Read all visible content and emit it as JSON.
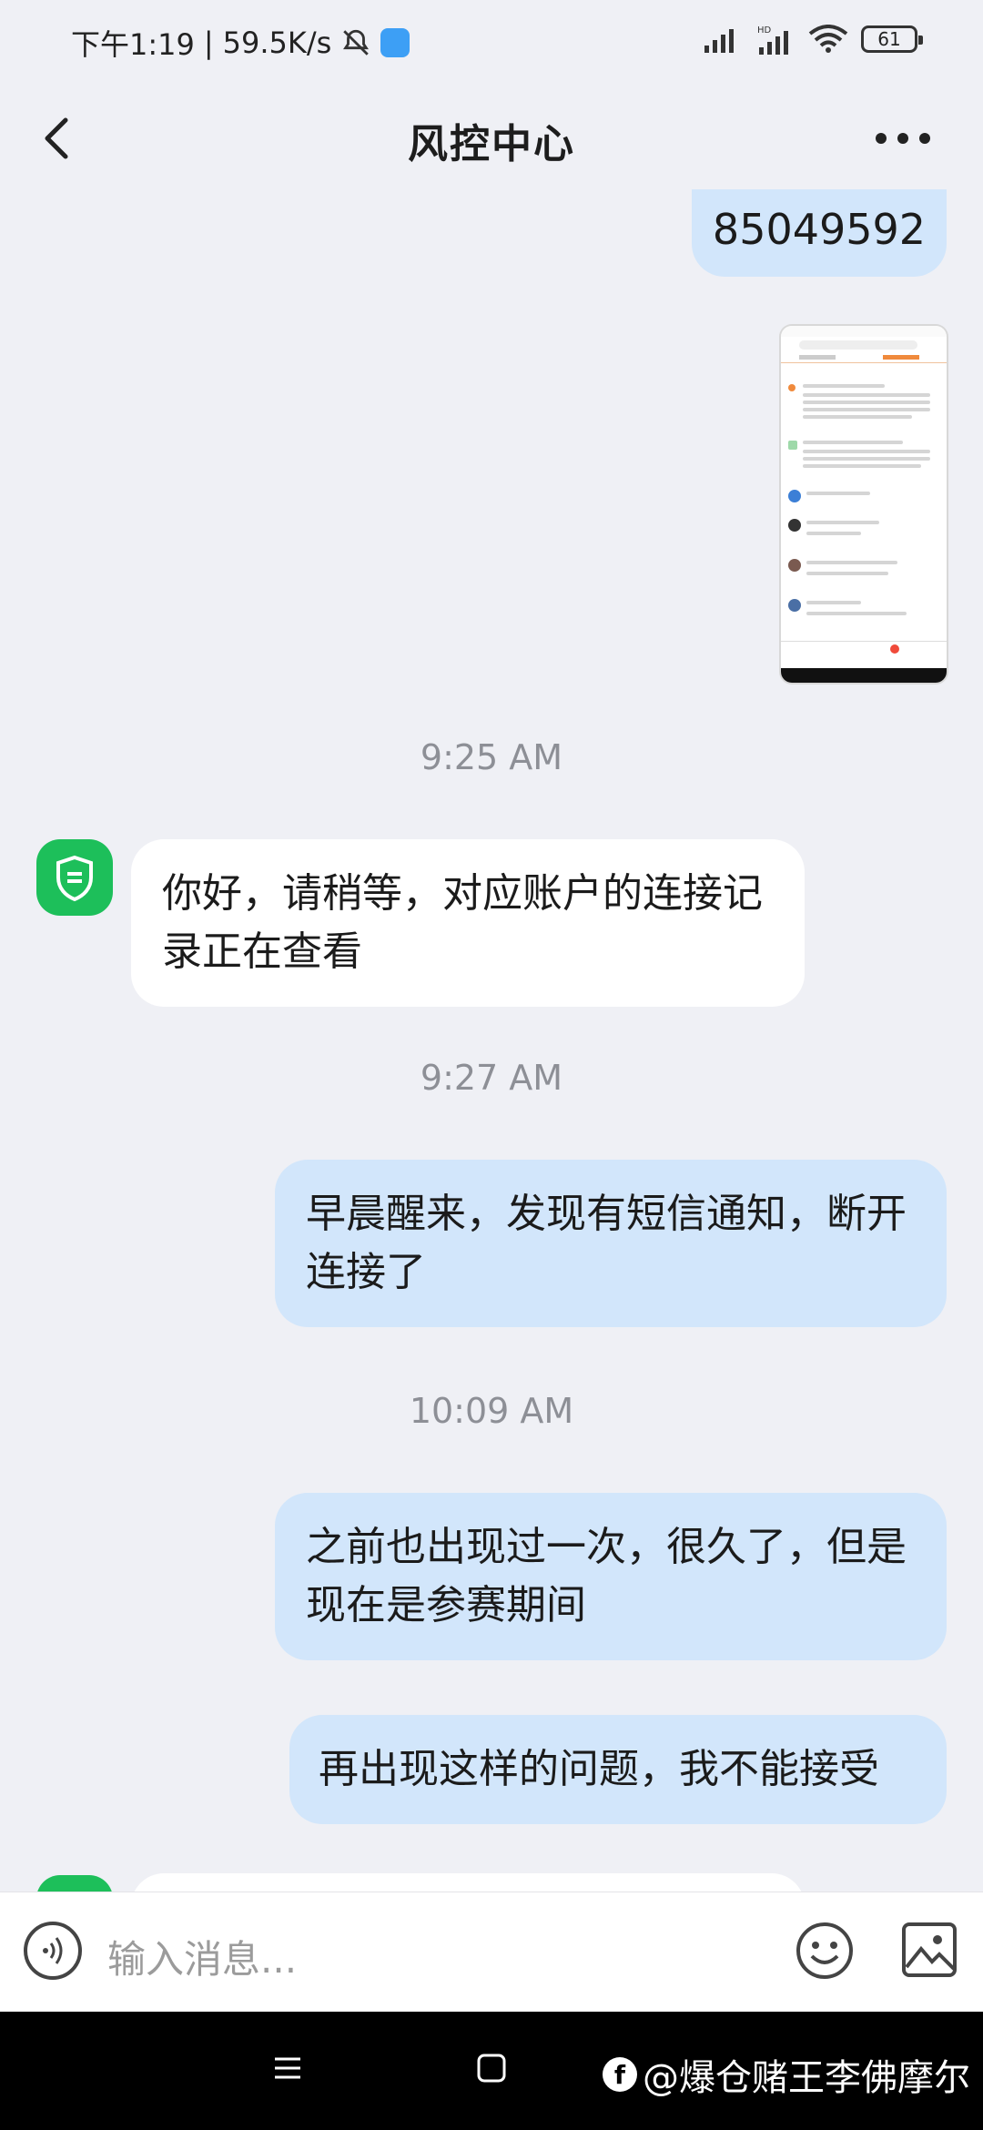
{
  "status_bar": {
    "time": "下午1:19",
    "network_speed": "59.5K/s",
    "battery": "61"
  },
  "header": {
    "title": "风控中心"
  },
  "messages": {
    "top_number": "85049592",
    "time_1": "9:25 AM",
    "agent_1": "你好，请稍等，对应账户的连接记录正在查看",
    "time_2": "9:27 AM",
    "user_1": "早晨醒来，发现有短信通知，断开连接了",
    "time_3": "10:09 AM",
    "user_2": "之前也出现过一次，很久了，但是现在是参赛期间",
    "user_3": "再出现这样的问题，我不能接受"
  },
  "input": {
    "placeholder": "输入消息..."
  },
  "watermark": "@爆仓赌王李佛摩尔",
  "colors": {
    "user_bubble": "#d2e6fb",
    "agent_bubble": "#ffffff",
    "agent_avatar": "#1dbf5a",
    "background": "#eff0f5"
  }
}
